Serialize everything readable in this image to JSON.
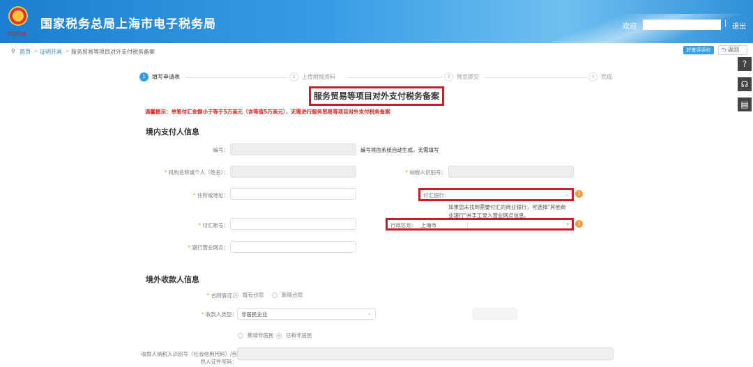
{
  "header": {
    "title": "国家税务总局上海市电子税务局",
    "seal": "中国税务",
    "welcome": "欢迎",
    "separator": "|",
    "logout": "退出"
  },
  "breadcrumb": {
    "home": "首页",
    "level1": "证明开具",
    "current": "服务贸易等项目对外支付税务备案",
    "sep": ">"
  },
  "topbuttons": {
    "evaluate": "好差评评价",
    "back": "返回"
  },
  "side": {
    "help": "?",
    "service": "☊",
    "manual": "▤"
  },
  "steps": [
    {
      "num": "1",
      "label": "填写申请表"
    },
    {
      "num": "2",
      "label": "上传附报资料"
    },
    {
      "num": "3",
      "label": "预览提交"
    },
    {
      "num": "4",
      "label": "完成"
    }
  ],
  "form_title": "服务贸易等项目对外支付税务备案",
  "warning": "温馨提示：单笔付汇金额小于等于5万美元（含等值5万美元），无需进行服务贸易等项目对外支付税务备案",
  "domestic": {
    "title": "境内支付人信息",
    "number_label": "编号：",
    "number_note": "编号将由系统自动生成，无需填写",
    "name_label": "机构名称或个人（姓名）：",
    "taxid_label": "纳税人识别号：",
    "address_label": "住所或地址：",
    "bank_label": "付汇银行：",
    "bank_hint1": "如果您未找到需要付汇的商业银行，可选择\"其他商",
    "bank_hint2": "业银行\"并手工录入营业网点信息。",
    "account_label": "付汇账号：",
    "region_label": "行政区划：",
    "region_value": "上海市",
    "branch_label": "银行营业网点：",
    "required": "*"
  },
  "foreign": {
    "title": "境外收款人信息",
    "contract_label": "合同情况：",
    "contract_options": [
      "既有合同",
      "新增合同"
    ],
    "payee_type_label": "收款人类型：",
    "payee_type_value": "非居民企业",
    "nonresident_options": [
      "新增非居民",
      "已有非居民"
    ],
    "payee_id_label": "收款人纳税人识别号（社会信用代码）/自然人证件号码："
  }
}
